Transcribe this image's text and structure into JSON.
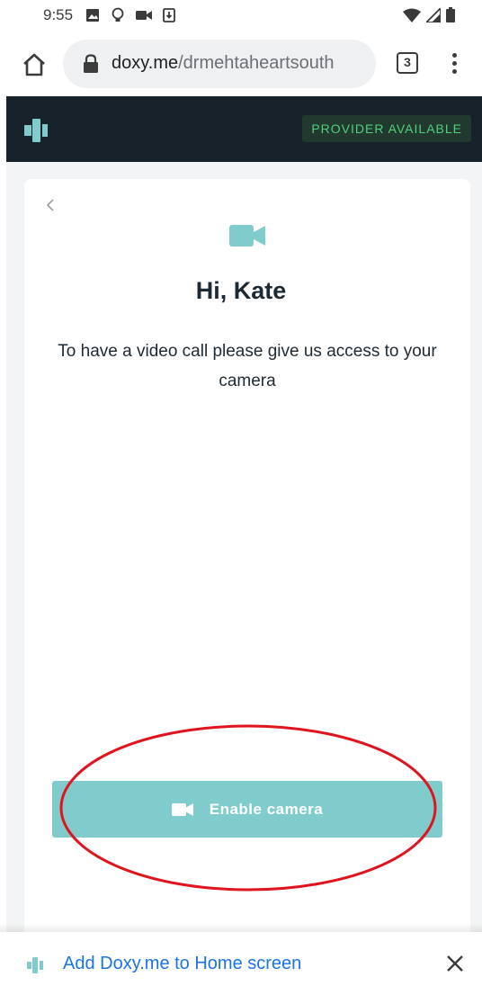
{
  "status_bar": {
    "time": "9:55",
    "left_icons": [
      "image-icon",
      "lightbulb-icon",
      "video-camera-icon",
      "download-icon"
    ],
    "right_icons": [
      "wifi-icon",
      "signal-icon",
      "battery-icon"
    ]
  },
  "browser": {
    "url_host": "doxy.me",
    "url_path": "/drmehtaheartsouth",
    "tab_count": "3"
  },
  "header": {
    "provider_status": "PROVIDER AVAILABLE"
  },
  "main": {
    "greeting": "Hi, Kate",
    "instruction": "To have a video call please give us access to your camera",
    "enable_button_label": "Enable camera"
  },
  "install_banner": {
    "text": "Add Doxy.me to Home screen"
  },
  "colors": {
    "brand_teal": "#80cccc",
    "header_bg": "#17222a",
    "provider_green": "#4fd07a",
    "annotation_red": "#e0141e",
    "link_blue": "#1a73e8"
  }
}
